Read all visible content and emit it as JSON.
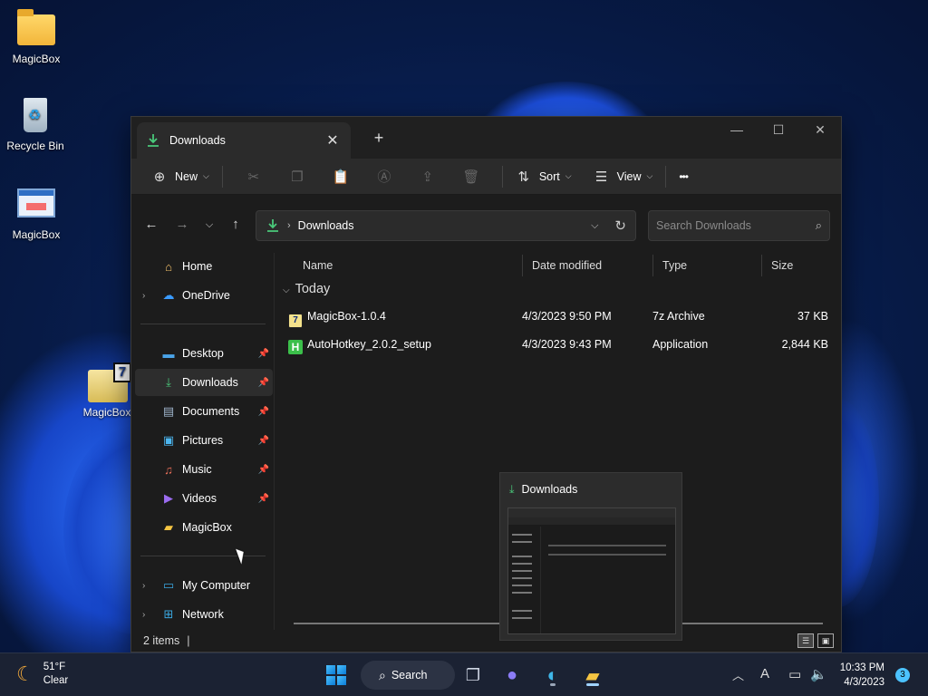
{
  "desktop": {
    "icons": [
      {
        "label": "MagicBox",
        "icon": "folder-icon"
      },
      {
        "label": "Recycle Bin",
        "icon": "recycle-bin-icon"
      },
      {
        "label": "MagicBox",
        "icon": "application-icon"
      },
      {
        "label": "MagicBox",
        "icon": "7z-archive-icon"
      }
    ]
  },
  "window": {
    "tab_title": "Downloads",
    "new_tab": "+",
    "controls": {
      "minimize": "—",
      "maximize": "☐",
      "close": "✕"
    },
    "commands": {
      "new_label": "New",
      "sort_label": "Sort",
      "view_label": "View",
      "more_label": "•••"
    },
    "address": {
      "path_label": "Downloads"
    },
    "search": {
      "placeholder": "Search Downloads"
    },
    "sidebar": {
      "items": [
        {
          "label": "Home",
          "icon": "home-icon"
        },
        {
          "label": "OneDrive",
          "icon": "cloud-icon"
        },
        {
          "label": "Desktop",
          "icon": "desktop-icon"
        },
        {
          "label": "Downloads",
          "icon": "download-icon"
        },
        {
          "label": "Documents",
          "icon": "document-icon"
        },
        {
          "label": "Pictures",
          "icon": "picture-icon"
        },
        {
          "label": "Music",
          "icon": "music-icon"
        },
        {
          "label": "Videos",
          "icon": "video-icon"
        },
        {
          "label": "MagicBox",
          "icon": "folder-icon"
        },
        {
          "label": "My Computer",
          "icon": "computer-icon"
        },
        {
          "label": "Network",
          "icon": "network-icon"
        }
      ]
    },
    "columns": {
      "name": "Name",
      "date": "Date modified",
      "type": "Type",
      "size": "Size"
    },
    "group_label": "Today",
    "files": [
      {
        "name": "MagicBox-1.0.4",
        "date": "4/3/2023 9:50 PM",
        "type": "7z Archive",
        "size": "37 KB",
        "icon": "7z-archive-icon"
      },
      {
        "name": "AutoHotkey_2.0.2_setup",
        "date": "4/3/2023 9:43 PM",
        "type": "Application",
        "size": "2,844 KB",
        "icon": "autohotkey-icon"
      }
    ],
    "status": {
      "items": "2 items",
      "separator": "|"
    }
  },
  "thumbnail": {
    "title": "Downloads"
  },
  "taskbar": {
    "weather": {
      "temp": "51°F",
      "condition": "Clear"
    },
    "search_label": "Search",
    "clock": {
      "time": "10:33 PM",
      "date": "4/3/2023"
    },
    "notifications": "3"
  },
  "colors": {
    "accent": "#4cc2ff",
    "download_green": "#4ac97b"
  }
}
